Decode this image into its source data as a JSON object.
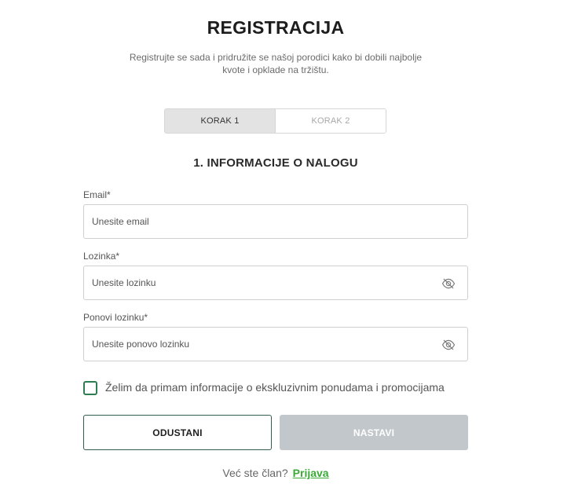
{
  "header": {
    "title": "REGISTRACIJA",
    "subtitle": "Registrujte se sada i pridružite se našoj porodici kako bi dobili najbolje kvote i opklade na tržištu."
  },
  "steps": [
    {
      "label": "KORAK 1",
      "active": true
    },
    {
      "label": "KORAK 2",
      "active": false
    }
  ],
  "section": {
    "title": "1. INFORMACIJE O NALOGU"
  },
  "form": {
    "email": {
      "label": "Email*",
      "placeholder": "Unesite email",
      "value": ""
    },
    "password": {
      "label": "Lozinka*",
      "placeholder": "Unesite lozinku",
      "value": "",
      "icon": "eye-off-icon"
    },
    "confirm_password": {
      "label": "Ponovi lozinku*",
      "placeholder": "Unesite ponovo lozinku",
      "value": "",
      "icon": "eye-off-icon"
    },
    "promo_checkbox": {
      "label": "Želim da primam informacije o ekskluzivnim ponudama i promocijama",
      "checked": false
    }
  },
  "buttons": {
    "cancel_label": "ODUSTANI",
    "next_label": "NASTAVI"
  },
  "footer": {
    "question": "Već ste član?",
    "login_link": "Prijava"
  },
  "colors": {
    "accent_green": "#3aa935",
    "checkbox_green": "#2e7d4f",
    "disabled_button": "#c2c7cb"
  }
}
